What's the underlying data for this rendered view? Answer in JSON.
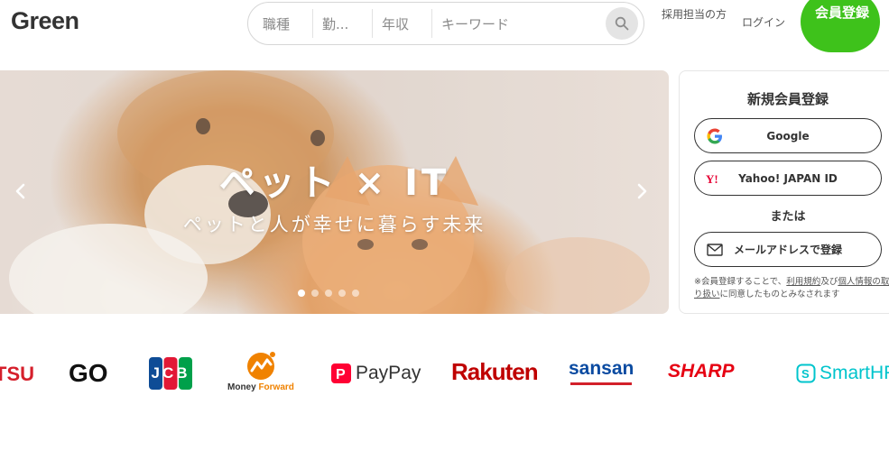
{
  "header": {
    "logo": "Green",
    "search": {
      "occupation": "職種",
      "location": "勤...",
      "income": "年収",
      "keyword": "キーワード"
    },
    "recruiter_link": "採用担当の方",
    "login_link": "ログイン",
    "signup_button": "会員登録"
  },
  "hero": {
    "title": "ペット × IT",
    "subtitle": "ペットと人が幸せに暮らす未来",
    "slide_count": 5,
    "active_slide": 1
  },
  "signup_panel": {
    "title": "新規会員登録",
    "google_button": "Google",
    "yahoo_button": "Yahoo! JAPAN ID",
    "or_label": "または",
    "mail_button": "メールアドレスで登録",
    "terms_prefix": "※会員登録することで、",
    "terms_link": "利用規約",
    "terms_mid": "及び",
    "privacy_link": "個人情報の取り扱い",
    "terms_suffix": "に同意したものとみなされます"
  },
  "logos": {
    "fujitsu": "TSU",
    "go": "GO",
    "jcb": "JCB",
    "moneyforward_1": "Money",
    "moneyforward_2": "Forward",
    "paypay": "PayPay",
    "rakuten": "Rakuten",
    "sansan": "sansan",
    "sharp": "SHARP",
    "smarthr": "SmartHR"
  },
  "colors": {
    "brand_green": "#3ec21b",
    "text": "#333333"
  }
}
